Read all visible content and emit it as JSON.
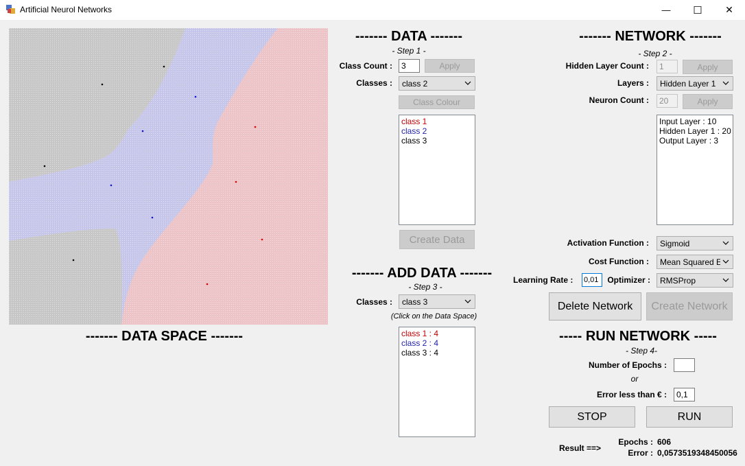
{
  "window": {
    "title": "Artificial Neurol Networks",
    "minimize": "—",
    "maximize": "☐",
    "close": "✕"
  },
  "data_space": {
    "title": "------- DATA SPACE -------"
  },
  "data": {
    "title": "------- DATA -------",
    "step": "- Step 1 -",
    "class_count_label": "Class Count :",
    "class_count_value": "3",
    "apply_label": "Apply",
    "classes_label": "Classes :",
    "classes_selected": "class 2",
    "class_colour_label": "Class Colour",
    "class_list": [
      {
        "label": "class 1",
        "color": "#c00000"
      },
      {
        "label": "class 2",
        "color": "#1f1fa8"
      },
      {
        "label": "class 3",
        "color": "#000000"
      }
    ],
    "create_data_label": "Create Data"
  },
  "add_data": {
    "title": "------- ADD DATA -------",
    "step": "- Step 3 -",
    "classes_label": "Classes :",
    "classes_selected": "class 3",
    "hint": "(Click on the Data Space)",
    "counts": [
      {
        "label": "class 1 : 4",
        "color": "#c00000"
      },
      {
        "label": "class 2 : 4",
        "color": "#1f1fa8"
      },
      {
        "label": "class 3 : 4",
        "color": "#000000"
      }
    ]
  },
  "network": {
    "title": "------- NETWORK -------",
    "step": "- Step 2 -",
    "hidden_layer_count_label": "Hidden Layer Count :",
    "hidden_layer_count_value": "1",
    "apply_label": "Apply",
    "layers_label": "Layers :",
    "layers_selected": "Hidden Layer 1",
    "neuron_count_label": "Neuron Count :",
    "neuron_count_value": "20",
    "layer_list": [
      "Input Layer : 10",
      "Hidden Layer 1 : 20",
      "Output Layer : 3"
    ],
    "activation_label": "Activation Function :",
    "activation_selected": "Sigmoid",
    "cost_label": "Cost Function :",
    "cost_selected": "Mean Squared Err",
    "learning_rate_label": "Learning Rate  :",
    "learning_rate_value": "0,01",
    "optimizer_label": "Optimizer :",
    "optimizer_selected": "RMSProp",
    "delete_label": "Delete  Network",
    "create_label": "Create Network"
  },
  "run": {
    "title": "----- RUN NETWORK -----",
    "step": "- Step 4-",
    "epochs_label": "Number of Epochs :",
    "epochs_value": "",
    "or_label": "or",
    "error_label": "Error less than € :",
    "error_value": "0,1",
    "stop_label": "STOP",
    "run_label": "RUN",
    "result_label": "Result ==>",
    "epochs_result_label": "Epochs :",
    "epochs_result_value": "606",
    "error_result_label": "Error :",
    "error_result_value": "0,0573519348450056"
  },
  "colors": {
    "region_class1": "#ecc3c6",
    "region_class2": "#c6c6ea",
    "region_class3": "#c7c7c7",
    "point_class1": "#e00000",
    "point_class2": "#1010d0",
    "point_class3": "#000000"
  }
}
